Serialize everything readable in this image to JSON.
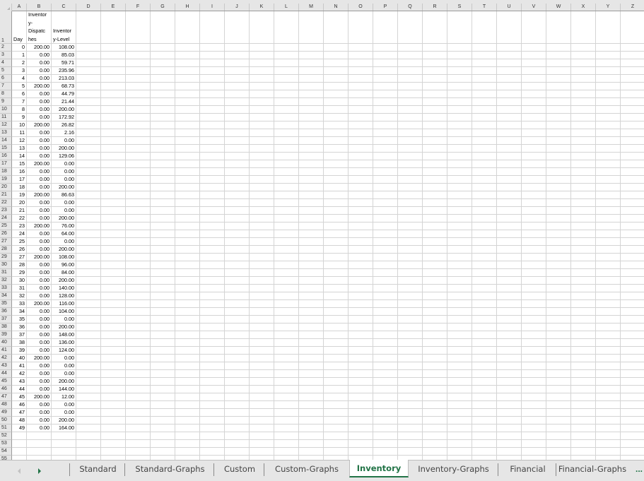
{
  "columns": [
    "A",
    "B",
    "C",
    "D",
    "E",
    "F",
    "G",
    "H",
    "I",
    "J",
    "K",
    "L",
    "M",
    "N",
    "O",
    "P",
    "Q",
    "R",
    "S",
    "T",
    "U",
    "V",
    "W",
    "X",
    "Y",
    "Z"
  ],
  "header_row": {
    "row_number": "1",
    "A": [
      "Day"
    ],
    "B": [
      "Inventor",
      "y-",
      "Dispatc",
      "hes"
    ],
    "C": [
      "Inventor",
      "y-Level"
    ]
  },
  "rows": [
    {
      "n": "2",
      "day": "0",
      "dispatches": "200.00",
      "level": "108.00"
    },
    {
      "n": "3",
      "day": "1",
      "dispatches": "0.00",
      "level": "85.03"
    },
    {
      "n": "4",
      "day": "2",
      "dispatches": "0.00",
      "level": "59.71"
    },
    {
      "n": "5",
      "day": "3",
      "dispatches": "0.00",
      "level": "235.96"
    },
    {
      "n": "6",
      "day": "4",
      "dispatches": "0.00",
      "level": "213.03"
    },
    {
      "n": "7",
      "day": "5",
      "dispatches": "200.00",
      "level": "68.73"
    },
    {
      "n": "8",
      "day": "6",
      "dispatches": "0.00",
      "level": "44.79"
    },
    {
      "n": "9",
      "day": "7",
      "dispatches": "0.00",
      "level": "21.44"
    },
    {
      "n": "10",
      "day": "8",
      "dispatches": "0.00",
      "level": "200.00"
    },
    {
      "n": "11",
      "day": "9",
      "dispatches": "0.00",
      "level": "172.92"
    },
    {
      "n": "12",
      "day": "10",
      "dispatches": "200.00",
      "level": "26.82"
    },
    {
      "n": "13",
      "day": "11",
      "dispatches": "0.00",
      "level": "2.16"
    },
    {
      "n": "14",
      "day": "12",
      "dispatches": "0.00",
      "level": "0.00"
    },
    {
      "n": "15",
      "day": "13",
      "dispatches": "0.00",
      "level": "200.00"
    },
    {
      "n": "16",
      "day": "14",
      "dispatches": "0.00",
      "level": "129.06"
    },
    {
      "n": "17",
      "day": "15",
      "dispatches": "200.00",
      "level": "0.00"
    },
    {
      "n": "18",
      "day": "16",
      "dispatches": "0.00",
      "level": "0.00"
    },
    {
      "n": "19",
      "day": "17",
      "dispatches": "0.00",
      "level": "0.00"
    },
    {
      "n": "20",
      "day": "18",
      "dispatches": "0.00",
      "level": "200.00"
    },
    {
      "n": "21",
      "day": "19",
      "dispatches": "200.00",
      "level": "86.63"
    },
    {
      "n": "22",
      "day": "20",
      "dispatches": "0.00",
      "level": "0.00"
    },
    {
      "n": "23",
      "day": "21",
      "dispatches": "0.00",
      "level": "0.00"
    },
    {
      "n": "24",
      "day": "22",
      "dispatches": "0.00",
      "level": "200.00"
    },
    {
      "n": "25",
      "day": "23",
      "dispatches": "200.00",
      "level": "76.00"
    },
    {
      "n": "26",
      "day": "24",
      "dispatches": "0.00",
      "level": "64.00"
    },
    {
      "n": "27",
      "day": "25",
      "dispatches": "0.00",
      "level": "0.00"
    },
    {
      "n": "28",
      "day": "26",
      "dispatches": "0.00",
      "level": "200.00"
    },
    {
      "n": "29",
      "day": "27",
      "dispatches": "200.00",
      "level": "108.00"
    },
    {
      "n": "30",
      "day": "28",
      "dispatches": "0.00",
      "level": "96.00"
    },
    {
      "n": "31",
      "day": "29",
      "dispatches": "0.00",
      "level": "84.00"
    },
    {
      "n": "32",
      "day": "30",
      "dispatches": "0.00",
      "level": "200.00"
    },
    {
      "n": "33",
      "day": "31",
      "dispatches": "0.00",
      "level": "140.00"
    },
    {
      "n": "34",
      "day": "32",
      "dispatches": "0.00",
      "level": "128.00"
    },
    {
      "n": "35",
      "day": "33",
      "dispatches": "200.00",
      "level": "116.00"
    },
    {
      "n": "36",
      "day": "34",
      "dispatches": "0.00",
      "level": "104.00"
    },
    {
      "n": "37",
      "day": "35",
      "dispatches": "0.00",
      "level": "0.00"
    },
    {
      "n": "38",
      "day": "36",
      "dispatches": "0.00",
      "level": "200.00"
    },
    {
      "n": "39",
      "day": "37",
      "dispatches": "0.00",
      "level": "148.00"
    },
    {
      "n": "40",
      "day": "38",
      "dispatches": "0.00",
      "level": "136.00"
    },
    {
      "n": "41",
      "day": "39",
      "dispatches": "0.00",
      "level": "124.00"
    },
    {
      "n": "42",
      "day": "40",
      "dispatches": "200.00",
      "level": "0.00"
    },
    {
      "n": "43",
      "day": "41",
      "dispatches": "0.00",
      "level": "0.00"
    },
    {
      "n": "44",
      "day": "42",
      "dispatches": "0.00",
      "level": "0.00"
    },
    {
      "n": "45",
      "day": "43",
      "dispatches": "0.00",
      "level": "200.00"
    },
    {
      "n": "46",
      "day": "44",
      "dispatches": "0.00",
      "level": "144.00"
    },
    {
      "n": "47",
      "day": "45",
      "dispatches": "200.00",
      "level": "12.00"
    },
    {
      "n": "48",
      "day": "46",
      "dispatches": "0.00",
      "level": "0.00"
    },
    {
      "n": "49",
      "day": "47",
      "dispatches": "0.00",
      "level": "0.00"
    },
    {
      "n": "50",
      "day": "48",
      "dispatches": "0.00",
      "level": "200.00"
    },
    {
      "n": "51",
      "day": "49",
      "dispatches": "0.00",
      "level": "164.00"
    },
    {
      "n": "52",
      "day": "",
      "dispatches": "",
      "level": ""
    },
    {
      "n": "53",
      "day": "",
      "dispatches": "",
      "level": ""
    },
    {
      "n": "54",
      "day": "",
      "dispatches": "",
      "level": ""
    },
    {
      "n": "55",
      "day": "",
      "dispatches": "",
      "level": ""
    }
  ],
  "sheet_tabs": [
    {
      "label": "Standard",
      "active": false
    },
    {
      "label": "Standard-Graphs",
      "active": false
    },
    {
      "label": "Custom",
      "active": false
    },
    {
      "label": "Custom-Graphs",
      "active": false
    },
    {
      "label": "Inventory",
      "active": true
    },
    {
      "label": "Inventory-Graphs",
      "active": false
    },
    {
      "label": "Financial",
      "active": false
    },
    {
      "label": "Financial-Graphs",
      "active": false
    }
  ],
  "tab_bar": {
    "prev_icon": "triangle-left",
    "next_icon": "triangle-right",
    "more_label": "..."
  },
  "colors": {
    "accent": "#217346",
    "header_bg": "#e6e6e6",
    "gridline": "#d4d4d4"
  }
}
